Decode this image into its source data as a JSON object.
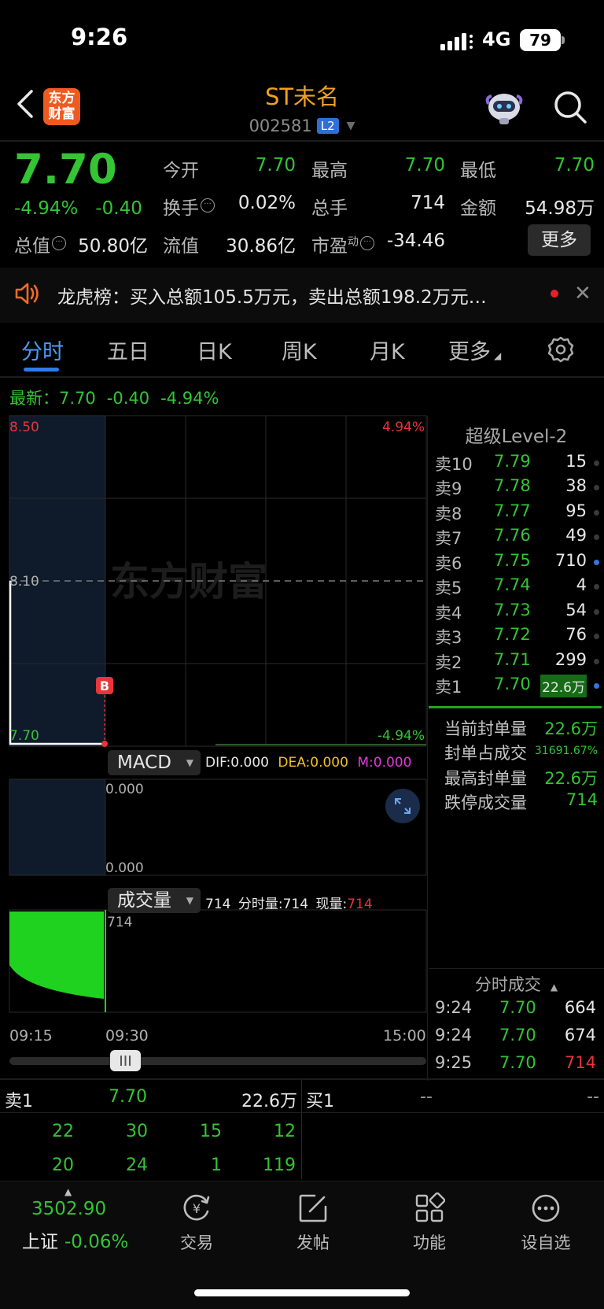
{
  "status": {
    "time": "9:26",
    "network": "4G",
    "battery": "79"
  },
  "header": {
    "logo_line1": "东方",
    "logo_line2": "财富",
    "title": "ST未名",
    "code": "002581",
    "badge": "L2"
  },
  "quote": {
    "price": "7.70",
    "pct": "-4.94%",
    "change": "-0.40",
    "stats": {
      "open_label": "今开",
      "open": "7.70",
      "high_label": "最高",
      "high": "7.70",
      "low_label": "最低",
      "low": "7.70",
      "turnover_label": "换手",
      "turnover": "0.02%",
      "volume_label": "总手",
      "volume": "714",
      "amount_label": "金额",
      "amount": "54.98万",
      "mktcap_label": "总值",
      "mktcap": "50.80亿",
      "float_label": "流值",
      "float": "30.86亿",
      "pe_label": "市盈",
      "pe_sup": "动",
      "pe": "-34.46"
    },
    "more_label": "更多"
  },
  "ticker": {
    "text": "龙虎榜：买入总额105.5万元，卖出总额198.2万元…"
  },
  "tabs": [
    "分时",
    "五日",
    "日K",
    "周K",
    "月K",
    "更多"
  ],
  "latest": {
    "label": "最新：",
    "price": "7.70",
    "change": "-0.40",
    "pct": "-4.94%"
  },
  "chart": {
    "y_top": "8.50",
    "y_top_pct": "4.94%",
    "y_mid": "8.10",
    "y_bottom": "7.70",
    "y_bottom_pct": "-4.94%",
    "watermark": "东方财富",
    "marker": "B"
  },
  "macd": {
    "name": "MACD",
    "dif_label": "DIF:",
    "dif": "0.000",
    "dea_label": "DEA:",
    "dea": "0.000",
    "m_label": "M:",
    "m": "0.000",
    "top": "0.000",
    "bottom": "0.000"
  },
  "volume": {
    "name": "成交量",
    "total": "714",
    "minute_label": "分时量:",
    "minute": "714",
    "current_label": "现量:",
    "current": "714",
    "axis_max": "714"
  },
  "time_axis": [
    "09:15",
    "09:30",
    "15:00"
  ],
  "orderbook": {
    "title": "超级Level-2",
    "rows": [
      {
        "label": "卖10",
        "price": "7.79",
        "vol": "15"
      },
      {
        "label": "卖9",
        "price": "7.78",
        "vol": "38"
      },
      {
        "label": "卖8",
        "price": "7.77",
        "vol": "95"
      },
      {
        "label": "卖7",
        "price": "7.76",
        "vol": "49"
      },
      {
        "label": "卖6",
        "price": "7.75",
        "vol": "710"
      },
      {
        "label": "卖5",
        "price": "7.74",
        "vol": "4"
      },
      {
        "label": "卖4",
        "price": "7.73",
        "vol": "54"
      },
      {
        "label": "卖3",
        "price": "7.72",
        "vol": "76"
      },
      {
        "label": "卖2",
        "price": "7.71",
        "vol": "299"
      },
      {
        "label": "卖1",
        "price": "7.70",
        "vol": "22.6万"
      }
    ]
  },
  "seal": [
    {
      "label": "当前封单量",
      "value": "22.6万"
    },
    {
      "label": "封单占成交",
      "value": "31691.67%"
    },
    {
      "label": "最高封单量",
      "value": "22.6万"
    },
    {
      "label": "跌停成交量",
      "value": "714"
    }
  ],
  "ticks": {
    "title": "分时成交",
    "rows": [
      {
        "time": "9:24",
        "price": "7.70",
        "vol": "664"
      },
      {
        "time": "9:24",
        "price": "7.70",
        "vol": "674"
      },
      {
        "time": "9:25",
        "price": "7.70",
        "vol": "714"
      }
    ]
  },
  "bottom_table": {
    "sell_label": "卖1",
    "sell_price": "7.70",
    "sell_vol": "22.6万",
    "buy_label": "买1",
    "buy_price": "--",
    "buy_vol": "--",
    "row1": [
      "22",
      "30",
      "15",
      "12"
    ],
    "row2": [
      "20",
      "24",
      "1",
      "119"
    ]
  },
  "index": {
    "value": "3502.90",
    "name": "上证",
    "pct": "-0.06%"
  },
  "tabbar": [
    {
      "label": "交易",
      "icon": "yen-exchange-icon"
    },
    {
      "label": "发帖",
      "icon": "edit-post-icon"
    },
    {
      "label": "功能",
      "icon": "grid-icon"
    },
    {
      "label": "设自选",
      "icon": "more-dots-icon"
    }
  ]
}
